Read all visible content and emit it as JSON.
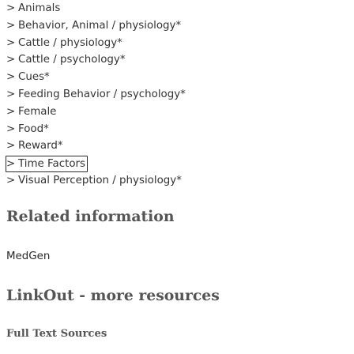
{
  "mesh_terms": {
    "chevron": ">",
    "items": [
      {
        "label": "Animals"
      },
      {
        "label": "Behavior, Animal / physiology*"
      },
      {
        "label": "Cattle / physiology*"
      },
      {
        "label": "Cattle / psychology*"
      },
      {
        "label": "Cues*"
      },
      {
        "label": "Feeding Behavior / psychology*"
      },
      {
        "label": "Female"
      },
      {
        "label": "Food*"
      },
      {
        "label": "Reward*"
      },
      {
        "label": "Time Factors"
      },
      {
        "label": "Visual Perception / physiology*"
      }
    ]
  },
  "related": {
    "title": "Related information",
    "links": [
      {
        "label": "MedGen"
      }
    ]
  },
  "linkout": {
    "title": "LinkOut - more resources",
    "subheading": "Full Text Sources"
  }
}
